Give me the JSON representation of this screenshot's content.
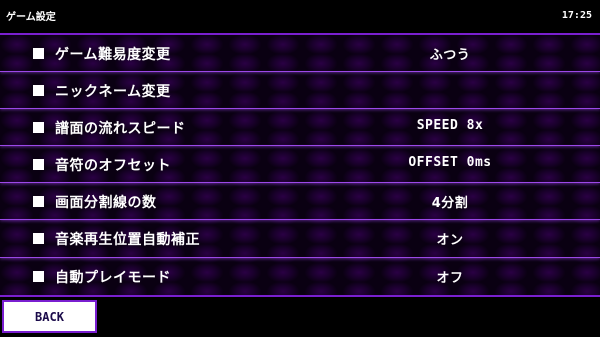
{
  "header": {
    "title": "ゲーム設定",
    "time": "17:25"
  },
  "settings": [
    {
      "label": "ゲーム難易度変更",
      "value": "ふつう"
    },
    {
      "label": "ニックネーム変更",
      "value": ""
    },
    {
      "label": "譜面の流れスピード",
      "value": "SPEED 8x"
    },
    {
      "label": "音符のオフセット",
      "value": "OFFSET 0ms"
    },
    {
      "label": "画面分割線の数",
      "value": "4分割"
    },
    {
      "label": "音楽再生位置自動補正",
      "value": "オン"
    },
    {
      "label": "自動プレイモード",
      "value": "オフ"
    }
  ],
  "footer": {
    "back_label": "BACK"
  },
  "colors": {
    "accent": "#7a1fd0",
    "row_divider": "#9b48e6",
    "background": "#000000"
  }
}
